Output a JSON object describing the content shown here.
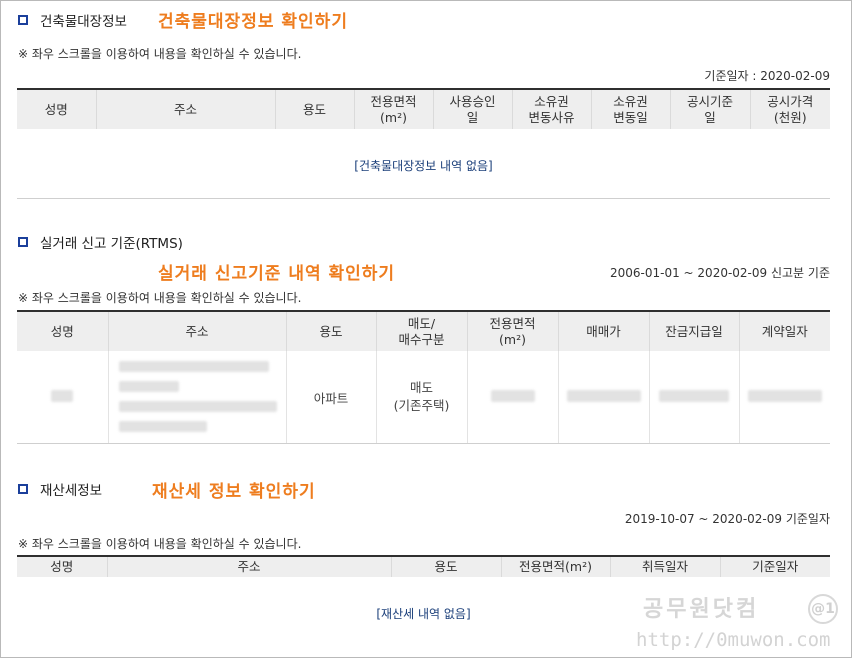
{
  "section1": {
    "title": "건축물대장정보",
    "annotation": "건축물대장정보 확인하기",
    "note": "※ 좌우 스크롤을 이용하여 내용을 확인하실 수 있습니다.",
    "meta": "기준일자 : 2020-02-09",
    "headers": [
      "성명",
      "주소",
      "용도",
      "전용면적\n(m²)",
      "사용승인\n일",
      "소유권\n변동사유",
      "소유권\n변동일",
      "공시기준\n일",
      "공시가격\n(천원)"
    ],
    "empty": "[건축물대장정보 내역 없음]"
  },
  "section2": {
    "title": "실거래 신고 기준(RTMS)",
    "annotation": "실거래 신고기준 내역 확인하기",
    "note": "※ 좌우 스크롤을 이용하여 내용을 확인하실 수 있습니다.",
    "meta": "2006-01-01 ~ 2020-02-09 신고분 기준",
    "headers": [
      "성명",
      "주소",
      "용도",
      "매도/\n매수구분",
      "전용면적\n(m²)",
      "매매가",
      "잔금지급일",
      "계약일자"
    ],
    "row": {
      "usage": "아파트",
      "trade_type": "매도",
      "trade_sub": "(기존주택)"
    }
  },
  "section3": {
    "title": "재산세정보",
    "annotation": "재산세 정보 확인하기",
    "note": "※ 좌우 스크롤을 이용하여 내용을 확인하실 수 있습니다.",
    "meta": "2019-10-07 ~ 2020-02-09 기준일자",
    "headers": [
      "성명",
      "주소",
      "용도",
      "전용면적(m²)",
      "취득일자",
      "기준일자"
    ],
    "empty": "[재산세 내역 없음]"
  },
  "watermark": {
    "name": "공무원닷컴",
    "url": "http://0muwon.com",
    "badge": "@1"
  }
}
